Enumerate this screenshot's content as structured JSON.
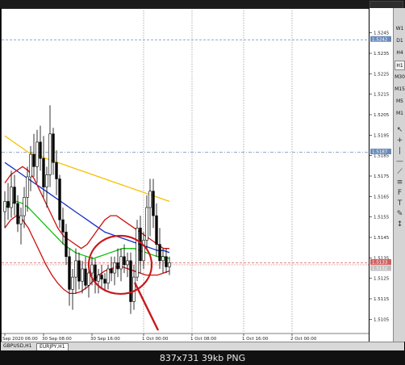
{
  "window": {
    "caption": "837x731  39kb  PNG"
  },
  "timeframes": [
    {
      "label": "M1",
      "active": false
    },
    {
      "label": "M5",
      "active": false
    },
    {
      "label": "M15",
      "active": false
    },
    {
      "label": "M30",
      "active": false
    },
    {
      "label": "H1",
      "active": true
    },
    {
      "label": "H4",
      "active": false
    },
    {
      "label": "D1",
      "active": false
    },
    {
      "label": "W1",
      "active": false
    }
  ],
  "toolbar_icons": [
    "cursor-icon",
    "crosshair-icon",
    "vertical-line-icon",
    "horizontal-line-icon",
    "trendline-icon",
    "channel-icon",
    "fibonacci-icon",
    "text-icon",
    "label-icon",
    "arrows-icon"
  ],
  "tabs": [
    {
      "label": "GBPUSD,H1",
      "active": false
    },
    {
      "label": "EURJPY,H1",
      "active": true
    }
  ],
  "colors": {
    "ema_yellow": "#f2c200",
    "ema_blue": "#1030c8",
    "envelope_red": "#cc1010",
    "ema_green": "#10c010",
    "candle": "#000000",
    "circle_annotation": "#c8181c",
    "horizontal_line_steel": "#6a8ab8",
    "horizontal_line_red": "#d06060",
    "grid": "#7f7f7f"
  },
  "chart_data": {
    "type": "candlestick",
    "symbol": "GBPUSD,H1",
    "ylim": [
      1.51,
      1.525
    ],
    "price_ticks": [
      "1.5245",
      "1.5235",
      "1.5225",
      "1.5215",
      "1.5205",
      "1.5195",
      "1.5185",
      "1.5175",
      "1.5165",
      "1.5155",
      "1.5145",
      "1.5135",
      "1.5125",
      "1.5115",
      "1.5105"
    ],
    "current_price_labels": [
      "1.5242",
      "1.5187",
      "1.5133",
      "1.5132"
    ],
    "time_labels": [
      {
        "x": 0,
        "label": "Sep 2020 06:00"
      },
      {
        "x": 12,
        "label": "30 Sep 08:00"
      },
      {
        "x": 27,
        "label": "30 Sep 16:00"
      },
      {
        "x": 43,
        "label": "1 Oct 00:00"
      },
      {
        "x": 58,
        "label": "1 Oct 08:00"
      },
      {
        "x": 74,
        "label": "1 Oct 16:00"
      },
      {
        "x": 89,
        "label": "2 Oct 00:00"
      }
    ],
    "candles": [
      [
        1.5158,
        1.5168,
        1.515,
        1.5163
      ],
      [
        1.5163,
        1.5172,
        1.5154,
        1.516
      ],
      [
        1.516,
        1.5178,
        1.5155,
        1.517
      ],
      [
        1.517,
        1.5176,
        1.5156,
        1.5162
      ],
      [
        1.5162,
        1.5166,
        1.5148,
        1.5152
      ],
      [
        1.5152,
        1.516,
        1.5142,
        1.5156
      ],
      [
        1.5156,
        1.517,
        1.515,
        1.5165
      ],
      [
        1.5165,
        1.518,
        1.5158,
        1.5175
      ],
      [
        1.5175,
        1.519,
        1.5168,
        1.5186
      ],
      [
        1.5186,
        1.5196,
        1.5175,
        1.518
      ],
      [
        1.518,
        1.5198,
        1.5172,
        1.5192
      ],
      [
        1.5192,
        1.52,
        1.5178,
        1.5184
      ],
      [
        1.5184,
        1.5195,
        1.5165,
        1.517
      ],
      [
        1.517,
        1.518,
        1.516,
        1.5176
      ],
      [
        1.5176,
        1.521,
        1.517,
        1.5196
      ],
      [
        1.5196,
        1.5199,
        1.5176,
        1.5182
      ],
      [
        1.5182,
        1.5188,
        1.5166,
        1.5174
      ],
      [
        1.5174,
        1.5176,
        1.515,
        1.5154
      ],
      [
        1.5154,
        1.516,
        1.5142,
        1.5148
      ],
      [
        1.5148,
        1.5152,
        1.5132,
        1.5136
      ],
      [
        1.5136,
        1.514,
        1.5112,
        1.512
      ],
      [
        1.512,
        1.513,
        1.511,
        1.5126
      ],
      [
        1.5126,
        1.514,
        1.5118,
        1.5134
      ],
      [
        1.5134,
        1.5138,
        1.512,
        1.5124
      ],
      [
        1.5124,
        1.5134,
        1.5118,
        1.513
      ],
      [
        1.513,
        1.5136,
        1.512,
        1.5122
      ],
      [
        1.5122,
        1.5132,
        1.5116,
        1.5128
      ],
      [
        1.5128,
        1.5136,
        1.5122,
        1.5132
      ],
      [
        1.5132,
        1.5135,
        1.5118,
        1.5124
      ],
      [
        1.5124,
        1.513,
        1.5118,
        1.5127
      ],
      [
        1.5127,
        1.5132,
        1.512,
        1.5125
      ],
      [
        1.5125,
        1.5128,
        1.5119,
        1.5123
      ],
      [
        1.5123,
        1.5132,
        1.512,
        1.513
      ],
      [
        1.513,
        1.5136,
        1.5124,
        1.5128
      ],
      [
        1.5128,
        1.5136,
        1.5122,
        1.5133
      ],
      [
        1.5133,
        1.514,
        1.5126,
        1.513
      ],
      [
        1.513,
        1.514,
        1.5124,
        1.5136
      ],
      [
        1.5136,
        1.5142,
        1.5128,
        1.5132
      ],
      [
        1.5132,
        1.5138,
        1.5126,
        1.5134
      ],
      [
        1.5134,
        1.5138,
        1.5108,
        1.5114
      ],
      [
        1.5114,
        1.5132,
        1.511,
        1.5126
      ],
      [
        1.5126,
        1.5154,
        1.5124,
        1.515
      ],
      [
        1.515,
        1.5156,
        1.5128,
        1.5134
      ],
      [
        1.5134,
        1.5148,
        1.513,
        1.5144
      ],
      [
        1.5144,
        1.5166,
        1.514,
        1.516
      ],
      [
        1.516,
        1.5174,
        1.5146,
        1.5168
      ],
      [
        1.5168,
        1.5174,
        1.515,
        1.5156
      ],
      [
        1.5156,
        1.5162,
        1.5136,
        1.5142
      ],
      [
        1.5142,
        1.515,
        1.513,
        1.5134
      ],
      [
        1.5134,
        1.514,
        1.5128,
        1.5136
      ],
      [
        1.5136,
        1.514,
        1.5128,
        1.5131
      ],
      [
        1.5131,
        1.5136,
        1.5127,
        1.5133
      ]
    ],
    "indicators": [
      {
        "color": "yellow",
        "values": [
          1.5195,
          1.5193,
          1.5191,
          1.5189,
          1.5187,
          1.5186,
          1.5185,
          1.5184,
          1.5183,
          1.5182,
          1.5181,
          1.518,
          1.5179,
          1.5178,
          1.5177,
          1.5176,
          1.5175,
          1.5174,
          1.5173,
          1.5172,
          1.5171,
          1.517,
          1.5169,
          1.5168,
          1.5167,
          1.5166,
          1.5165,
          1.5164,
          1.5163
        ]
      },
      {
        "color": "blue",
        "values": [
          1.5182,
          1.518,
          1.5178,
          1.5176,
          1.5174,
          1.5172,
          1.517,
          1.5168,
          1.5166,
          1.5164,
          1.5162,
          1.516,
          1.5158,
          1.5156,
          1.5154,
          1.5152,
          1.515,
          1.5148,
          1.5147,
          1.5146,
          1.5145,
          1.5144,
          1.5143,
          1.5142,
          1.5141,
          1.514,
          1.5139,
          1.5139,
          1.5138
        ]
      },
      {
        "color": "red",
        "values": [
          1.5172,
          1.5176,
          1.5178,
          1.518,
          1.5178,
          1.5174,
          1.5168,
          1.5162,
          1.5156,
          1.515,
          1.5146,
          1.5144,
          1.5142,
          1.514,
          1.5142,
          1.5146,
          1.515,
          1.5154,
          1.5156,
          1.5156,
          1.5154,
          1.5152,
          1.515,
          1.5148,
          1.5146,
          1.5144,
          1.5142,
          1.514,
          1.514
        ]
      },
      {
        "color": "green",
        "values": [
          1.516,
          1.5162,
          1.5163,
          1.5162,
          1.516,
          1.5157,
          1.5154,
          1.5151,
          1.5148,
          1.5145,
          1.5142,
          1.514,
          1.5138,
          1.5137,
          1.5136,
          1.5135,
          1.5136,
          1.5137,
          1.5138,
          1.5139,
          1.514,
          1.514,
          1.514,
          1.5139,
          1.5138,
          1.5137,
          1.5136,
          1.5136,
          1.5135
        ]
      },
      {
        "color": "red",
        "values": [
          1.515,
          1.5154,
          1.5156,
          1.5154,
          1.515,
          1.5144,
          1.5138,
          1.5132,
          1.5127,
          1.5123,
          1.512,
          1.5118,
          1.5118,
          1.5119,
          1.5121,
          1.5124,
          1.5127,
          1.5129,
          1.513,
          1.5131,
          1.5131,
          1.513,
          1.5129,
          1.5128,
          1.5127,
          1.5127,
          1.5127,
          1.5128,
          1.5129
        ]
      }
    ],
    "hlines": [
      {
        "price": 1.5242,
        "style": "dashed",
        "color": "steel"
      },
      {
        "price": 1.5187,
        "style": "dashdot",
        "color": "steel"
      },
      {
        "price": 1.5133,
        "style": "dashed",
        "color": "red"
      },
      {
        "price": 1.5132,
        "style": "dotted",
        "color": "red"
      }
    ],
    "vlines": [
      43,
      58,
      74,
      89
    ],
    "annotation": {
      "type": "circle-and-arrow",
      "center_price": 1.5132
    }
  }
}
